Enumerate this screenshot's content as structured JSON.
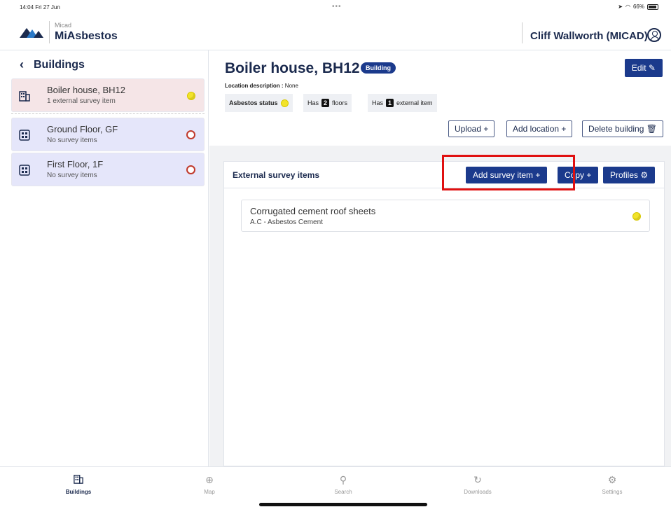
{
  "status_bar": {
    "time": "14:04  Fri 27 Jun",
    "dots": "•••",
    "battery": "66%"
  },
  "header": {
    "brand_small": "Micad",
    "brand_big": "MiAsbestos",
    "user_name": "Cliff Wallworth (MICAD)"
  },
  "sidebar": {
    "title": "Buildings",
    "items": [
      {
        "label": "Boiler house, BH12",
        "sub": "1 external survey item",
        "type": "building",
        "status": "yellow"
      },
      {
        "label": "Ground Floor, GF",
        "sub": "No survey items",
        "type": "floor",
        "status": "red-ring"
      },
      {
        "label": "First Floor, 1F",
        "sub": "No survey items",
        "type": "floor",
        "status": "red-ring"
      }
    ]
  },
  "main": {
    "title": "Boiler house, BH12",
    "badge": "Building",
    "edit_label": "Edit ✎",
    "location_label": "Location description :",
    "location_value": "None",
    "asbestos_status_label": "Asbestos status",
    "floors_prefix": "Has",
    "floors_count": "2",
    "floors_suffix": "floors",
    "external_prefix": "Has",
    "external_count": "1",
    "external_suffix": "external item",
    "buttons": {
      "upload": "Upload +",
      "add_location": "Add location +",
      "delete_building": "Delete building 🗑"
    },
    "panel": {
      "title": "External survey items",
      "add_survey_item": "Add survey item +",
      "copy": "Copy +",
      "profiles": "Profiles ⚙",
      "items": [
        {
          "label": "Corrugated cement roof sheets",
          "sub": "A.C - Asbestos Cement",
          "status": "yellow"
        }
      ]
    }
  },
  "tabs": [
    {
      "label": "Buildings",
      "active": true
    },
    {
      "label": "Map",
      "active": false
    },
    {
      "label": "Search",
      "active": false
    },
    {
      "label": "Downloads",
      "active": false
    },
    {
      "label": "Settings",
      "active": false
    }
  ],
  "colors": {
    "accent": "#1b3a8c",
    "building_bg": "#f5e5e7",
    "floor_bg": "#e5e6fa",
    "highlight": "#e01010"
  }
}
